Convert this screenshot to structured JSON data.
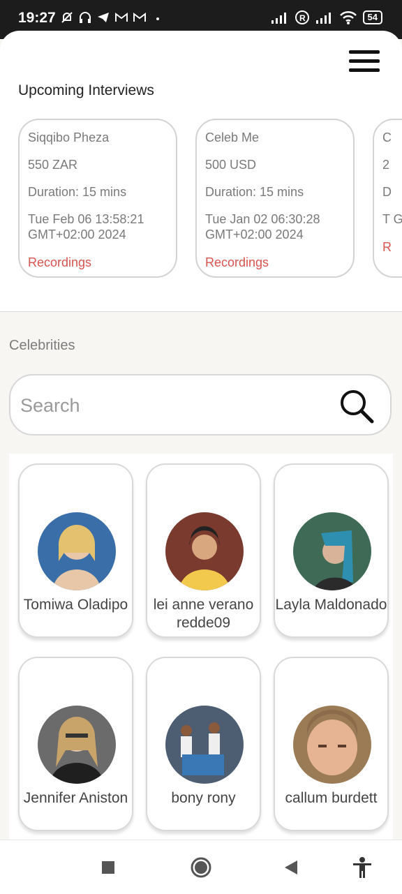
{
  "status_bar": {
    "time": "19:27",
    "battery": "54"
  },
  "header": {
    "section_title": "Upcoming Interviews"
  },
  "interviews": [
    {
      "name": "Siqqibo Pheza",
      "price": "550 ZAR",
      "duration": "Duration: 15 mins",
      "date": "Tue Feb 06 13:58:21 GMT+02:00 2024",
      "link": "Recordings"
    },
    {
      "name": "Celeb Me",
      "price": "500 USD",
      "duration": "Duration: 15 mins",
      "date": "Tue Jan 02 06:30:28 GMT+02:00 2024",
      "link": "Recordings"
    },
    {
      "name": "C",
      "price": "2",
      "duration": "D",
      "date": "T G",
      "link": "R"
    }
  ],
  "celebrities": {
    "label": "Celebrities",
    "search_placeholder": "Search",
    "items": [
      {
        "name": "Tomiwa Oladipo",
        "avatar_color": "#3a6ea8"
      },
      {
        "name": "lei anne verano redde09",
        "avatar_color": "#7a3b2e"
      },
      {
        "name": "Layla Maldonado",
        "avatar_color": "#3f6a55"
      },
      {
        "name": "Jennifer Aniston",
        "avatar_color": "#6b6b6b"
      },
      {
        "name": "bony rony",
        "avatar_color": "#4d5d72"
      },
      {
        "name": "callum burdett",
        "avatar_color": "#9b7b56"
      }
    ]
  },
  "colors": {
    "accent": "#d9534f",
    "background": "#f7f6f3"
  }
}
